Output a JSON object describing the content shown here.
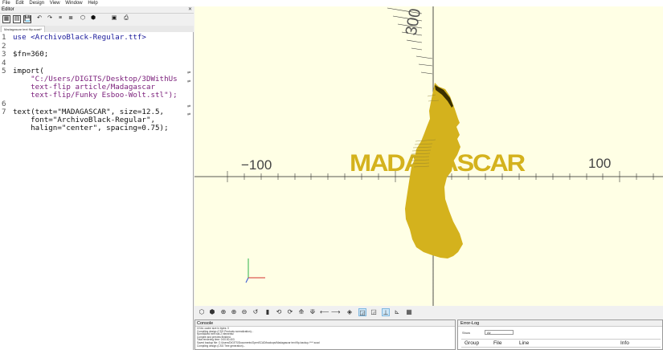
{
  "menu": [
    "File",
    "Edit",
    "Design",
    "View",
    "Window",
    "Help"
  ],
  "editor": {
    "title": "Editor",
    "close": "✕",
    "tab": "Madagascar text flip.scad*",
    "toolbar_glyphs": [
      "▦",
      "▤",
      "💾",
      "↶",
      "↷",
      "≡",
      "≣",
      "⬡",
      "⬢",
      "▣",
      "⎙"
    ],
    "line_numbers": [
      "1",
      "2",
      "3",
      "4",
      "5",
      "",
      "",
      "",
      "6",
      "7",
      "",
      ""
    ],
    "lines": [
      "use <ArchivoBlack-Regular.ttf>",
      "",
      "$fn=360;",
      "",
      "import(",
      "    \"C:/Users/DIGITS/Desktop/3DWithUs",
      "    text-flip article/Madagascar",
      "    text-flip/Funky Esboo-Wolt.stl\");",
      "",
      "text(text=\"MADAGASCAR\", size=12.5,",
      "    font=\"ArchivoBlack-Regular\",",
      "    halign=\"center\", spacing=0.75);"
    ],
    "fold_marks": [
      "⇌",
      "⇌",
      "⇌",
      "⇌"
    ]
  },
  "viewport": {
    "background": "#ffffe5",
    "model_color": "#d4b21d",
    "axis_labels": [
      "300",
      "−100",
      "100"
    ],
    "text_model": "MADAGASCAR"
  },
  "view_toolbar": [
    "⬡",
    "⬢",
    "⊕",
    "⊖",
    "⊙",
    "↺",
    "▮",
    "⟲",
    "⟳",
    "⟰",
    "⟱",
    "⟵",
    "⟶",
    "◈",
    "⚡",
    "◲",
    "⊥",
    "⊾",
    "▦"
  ],
  "console": {
    "title": "Console",
    "close": "✕",
    "lines": [
      "CGAL cache size in bytes: 0",
      "Compiling design (CSG Products normalization)...",
      "Normalized tree has 2 elements!",
      "Compile and preview finished.",
      "Total rendering time: 0:00:00.403",
      "Saved backup file: C:/Users/DIGITS/Documents/OpenSCAD/backups/Madagascar text flip-backup-****.scad",
      "Compiling design (CSG Tree generation)..."
    ]
  },
  "errorlog": {
    "title": "Error-Log",
    "close": "✕",
    "show_label": "Show",
    "show_value": "All",
    "columns": [
      "Group",
      "File",
      "Line",
      "Info"
    ]
  }
}
